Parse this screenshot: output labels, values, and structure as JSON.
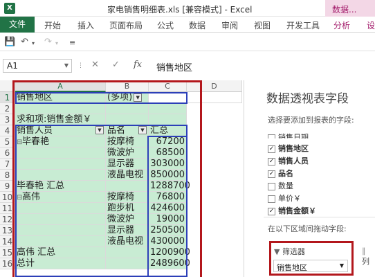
{
  "window": {
    "title": "家电销售明细表.xls  [兼容模式] - Excel",
    "contextual_tab": "数据..."
  },
  "ribbon": {
    "file": "文件",
    "tabs": [
      "开始",
      "插入",
      "页面布局",
      "公式",
      "数据",
      "审阅",
      "视图",
      "开发工具",
      "分析",
      "设"
    ]
  },
  "formula_bar": {
    "name_box": "A1",
    "content": "销售地区"
  },
  "sheet": {
    "columns": [
      "A",
      "B",
      "C",
      "D"
    ],
    "rows": [
      "1",
      "2",
      "3",
      "4",
      "5",
      "6",
      "7",
      "8",
      "9",
      "10",
      "11",
      "12",
      "13",
      "14",
      "15",
      "16"
    ],
    "filter_field": "销售地区",
    "filter_value": "(多项)",
    "sum_label": "求和项:销售金额￥",
    "row_header_1": "销售人员",
    "row_header_2": "品名",
    "col_header": "汇总",
    "groups": [
      {
        "person": "毕春艳",
        "items": [
          {
            "product": "按摩椅",
            "amount": "67200"
          },
          {
            "product": "微波炉",
            "amount": "68500"
          },
          {
            "product": "显示器",
            "amount": "303000"
          },
          {
            "product": "液晶电视",
            "amount": "850000"
          }
        ],
        "total_label": "毕春艳 汇总",
        "total": "1288700"
      },
      {
        "person": "高伟",
        "items": [
          {
            "product": "按摩椅",
            "amount": "76800"
          },
          {
            "product": "跑步机",
            "amount": "424600"
          },
          {
            "product": "微波炉",
            "amount": "19000"
          },
          {
            "product": "显示器",
            "amount": "250500"
          },
          {
            "product": "液晶电视",
            "amount": "430000"
          }
        ],
        "total_label": "高伟 汇总",
        "total": "1200900"
      }
    ],
    "grand_total_label": "总计",
    "grand_total": "2489600"
  },
  "pivot_pane": {
    "title": "数据透视表字段",
    "subtitle": "选择要添加到报表的字段:",
    "fields": [
      {
        "label": "销售日期",
        "checked": false
      },
      {
        "label": "销售地区",
        "checked": true
      },
      {
        "label": "销售人员",
        "checked": true
      },
      {
        "label": "品名",
        "checked": true
      },
      {
        "label": "数量",
        "checked": false
      },
      {
        "label": "单价￥",
        "checked": false
      },
      {
        "label": "销售金额￥",
        "checked": true
      }
    ],
    "areas_hint": "在以下区域间拖动字段:",
    "filter_area_label": "筛选器",
    "filter_area_item": "销售地区",
    "column_area_label": "列"
  }
}
